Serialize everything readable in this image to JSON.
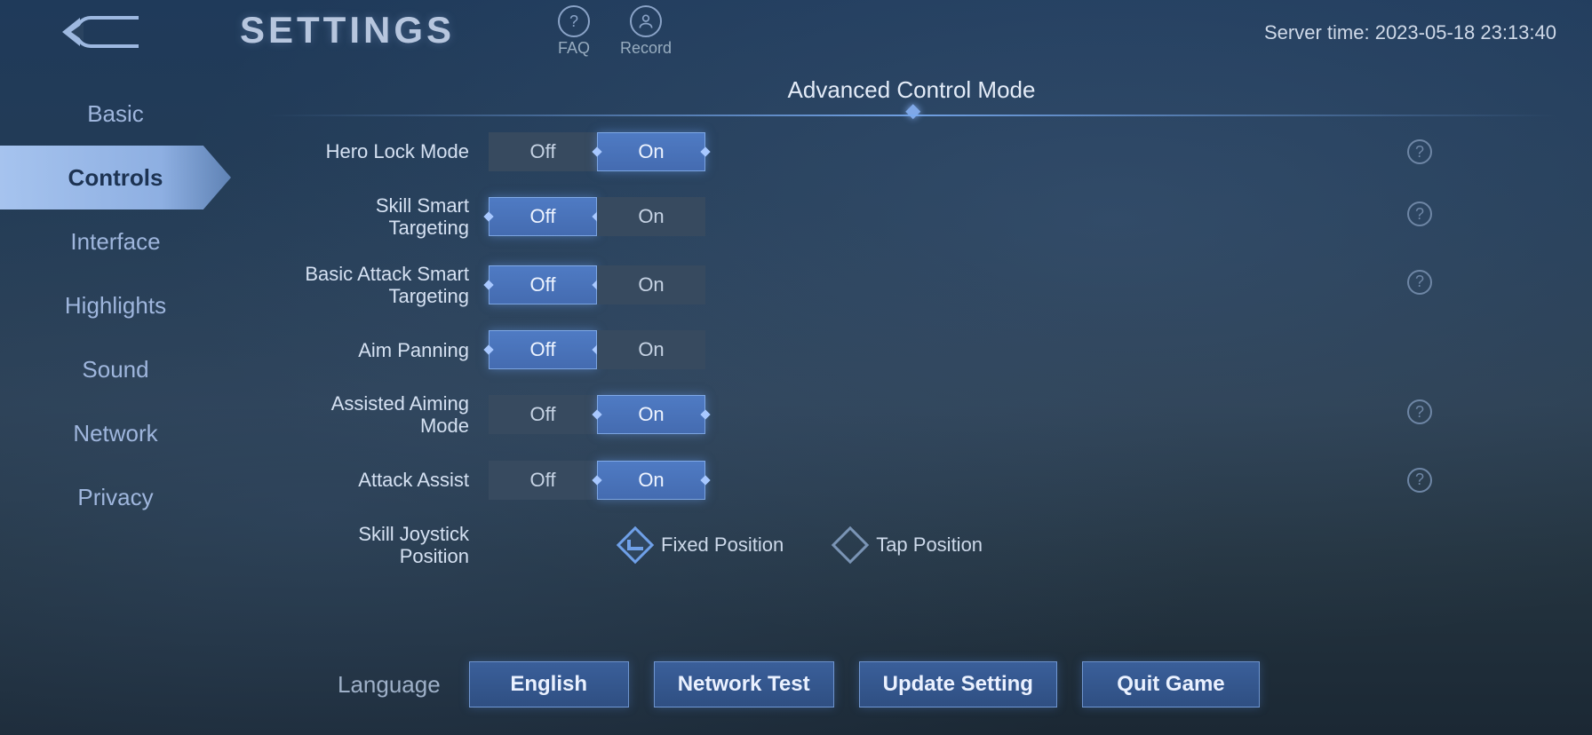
{
  "header": {
    "title": "SETTINGS",
    "faq_label": "FAQ",
    "record_label": "Record",
    "server_time_prefix": "Server time: ",
    "server_time": "2023-05-18 23:13:40"
  },
  "sidebar": {
    "items": [
      {
        "label": "Basic",
        "active": false
      },
      {
        "label": "Controls",
        "active": true
      },
      {
        "label": "Interface",
        "active": false
      },
      {
        "label": "Highlights",
        "active": false
      },
      {
        "label": "Sound",
        "active": false
      },
      {
        "label": "Network",
        "active": false
      },
      {
        "label": "Privacy",
        "active": false
      }
    ]
  },
  "section": {
    "title": "Advanced Control Mode",
    "off_label": "Off",
    "on_label": "On",
    "rows": [
      {
        "label": "Hero Lock Mode",
        "value": "On",
        "help": true
      },
      {
        "label": "Skill Smart Targeting",
        "value": "Off",
        "help": true
      },
      {
        "label": "Basic Attack Smart Targeting",
        "value": "Off",
        "help": true
      },
      {
        "label": "Aim Panning",
        "value": "Off",
        "help": false
      },
      {
        "label": "Assisted Aiming Mode",
        "value": "On",
        "help": true
      },
      {
        "label": "Attack Assist",
        "value": "On",
        "help": true
      }
    ],
    "radio": {
      "label": "Skill Joystick Position",
      "options": [
        {
          "label": "Fixed Position",
          "checked": true
        },
        {
          "label": "Tap Position",
          "checked": false
        }
      ]
    }
  },
  "footer": {
    "language_label": "Language",
    "language_value": "English",
    "network_test": "Network Test",
    "update_setting": "Update Setting",
    "quit_game": "Quit Game"
  }
}
